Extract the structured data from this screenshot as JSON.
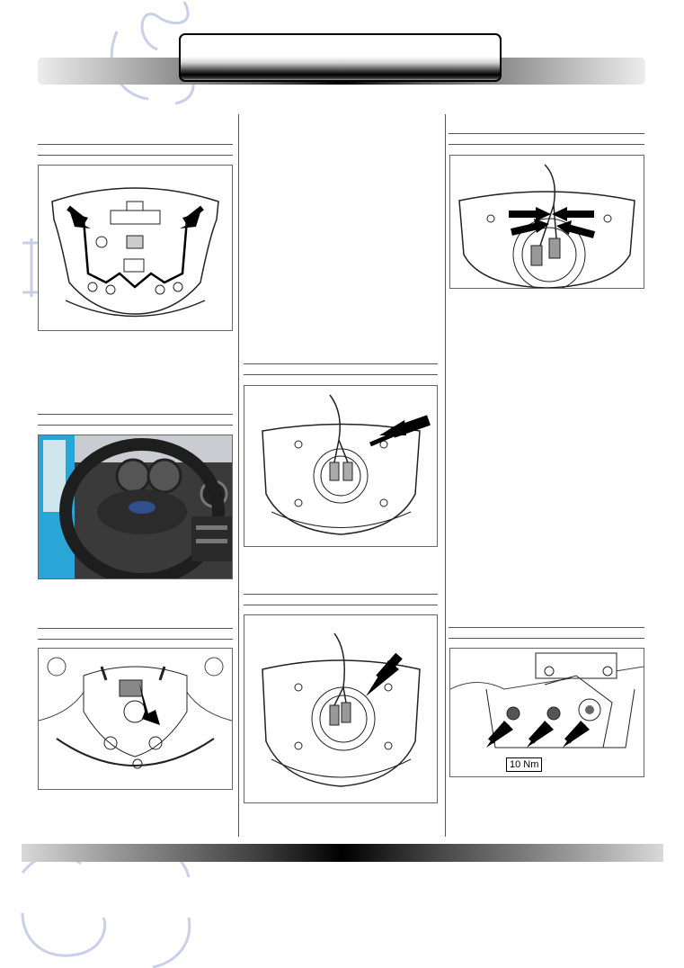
{
  "colors": {
    "watermark": "#c9cfe8",
    "car_paint": "#2aa6d6",
    "dashboard": "#3a3a3a"
  },
  "figures": [
    {
      "id": "fig-airbag-rear-arrows",
      "description_icon": "airbag-rear-view"
    },
    {
      "id": "fig-steering-wheel-photo",
      "description_icon": "steering-wheel-photo"
    },
    {
      "id": "fig-wheel-connector",
      "description_icon": "steering-wheel-back"
    },
    {
      "id": "fig-airbag-harness",
      "description_icon": "airbag-harness-view"
    },
    {
      "id": "fig-airbag-connectors",
      "description_icon": "airbag-connector-view"
    },
    {
      "id": "fig-airbag-clips",
      "description_icon": "airbag-clips-view"
    },
    {
      "id": "fig-bracket-bolts",
      "description_icon": "bracket-bolts-view"
    }
  ],
  "torque_label": "10 Nm"
}
